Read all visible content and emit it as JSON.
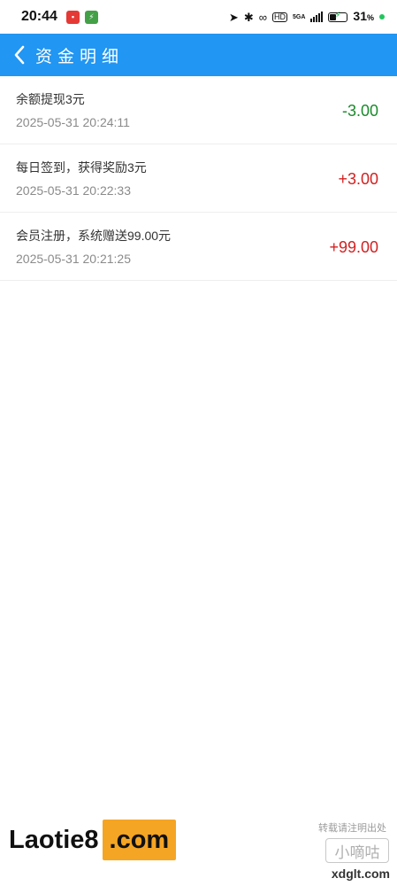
{
  "statusbar": {
    "time": "20:44",
    "network": "5GA",
    "battery_pct": "31",
    "battery_unit": "%",
    "battery_level": 0.31
  },
  "header": {
    "title": "资金明细"
  },
  "records": [
    {
      "title": "余额提现3元",
      "time": "2025-05-31 20:24:11",
      "amount": "-3.00",
      "color": "#1a8a2a"
    },
    {
      "title": "每日签到，获得奖励3元",
      "time": "2025-05-31 20:22:33",
      "amount": "+3.00",
      "color": "#d32020"
    },
    {
      "title": "会员注册，系统赠送99.00元",
      "time": "2025-05-31 20:21:25",
      "amount": "+99.00",
      "color": "#d32020"
    }
  ],
  "watermark": {
    "main": "Laotie8",
    "com": ".com",
    "right_top": "转载请注明出处",
    "right_mid": "小嘀咕",
    "right_bottom": "xdglt.com"
  },
  "colors": {
    "header_bg": "#2196f3",
    "negative": "#1a8a2a",
    "positive": "#d32020"
  }
}
